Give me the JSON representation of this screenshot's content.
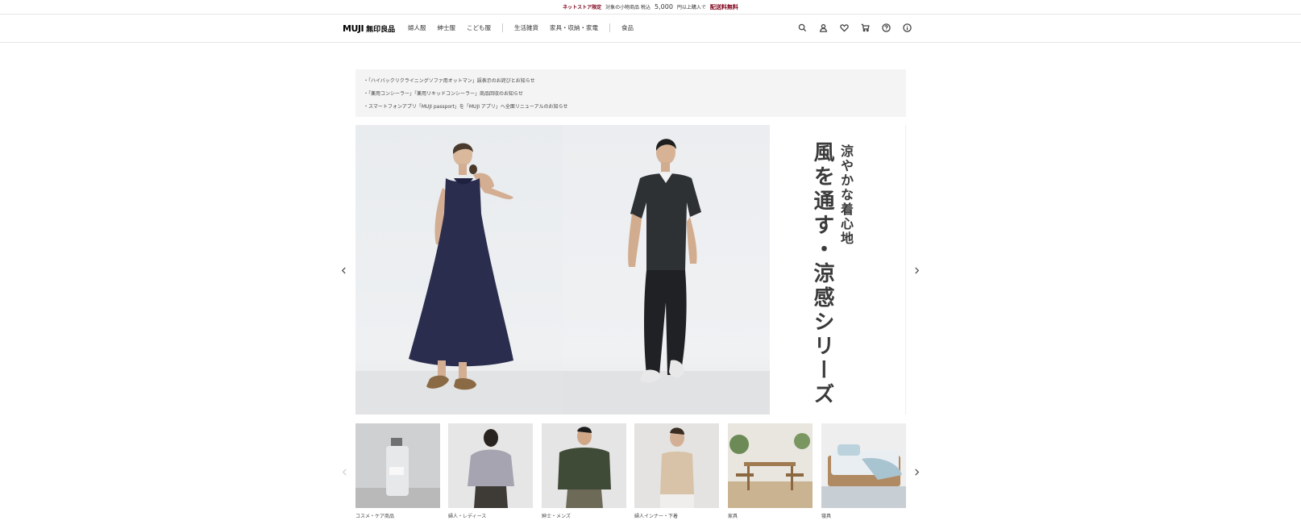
{
  "promo": {
    "tag": "ネットストア限定",
    "text": "対象の小物商品 税込",
    "amount": "5,000",
    "text2": "円以上購入で",
    "free": "配送料無料"
  },
  "header": {
    "logo_en": "MUJI",
    "logo_jp": "無印良品",
    "nav": [
      "婦人服",
      "紳士服",
      "こども服",
      "生活雑貨",
      "家具・収納・家電",
      "食品"
    ],
    "icons": [
      "search-icon",
      "user-icon",
      "heart-icon",
      "cart-icon",
      "help-icon",
      "info-icon"
    ]
  },
  "notices": [
    "・「ハイバックリクライニングソファ用オットマン」誤表示のお詫びとお知らせ",
    "・「薬用コンシーラー」「薬用リキッドコンシーラー」商品回収のお知らせ",
    "・スマートフォンアプリ「MUJI passport」を「MUJI アプリ」へ全面リニューアルのお知らせ"
  ],
  "hero": {
    "subtitle": "涼やかな着心地",
    "title": "風を通す・涼感シリーズ"
  },
  "categories": [
    {
      "label": "コスメ・ケア商品"
    },
    {
      "label": "婦人・レディース"
    },
    {
      "label": "紳士・メンズ"
    },
    {
      "label": "婦人インナー・下着"
    },
    {
      "label": "家具"
    },
    {
      "label": "寝具"
    }
  ],
  "colors": {
    "accent": "#7f0019",
    "notice_bg": "#f4f4f4",
    "border": "#e6e6e6"
  }
}
